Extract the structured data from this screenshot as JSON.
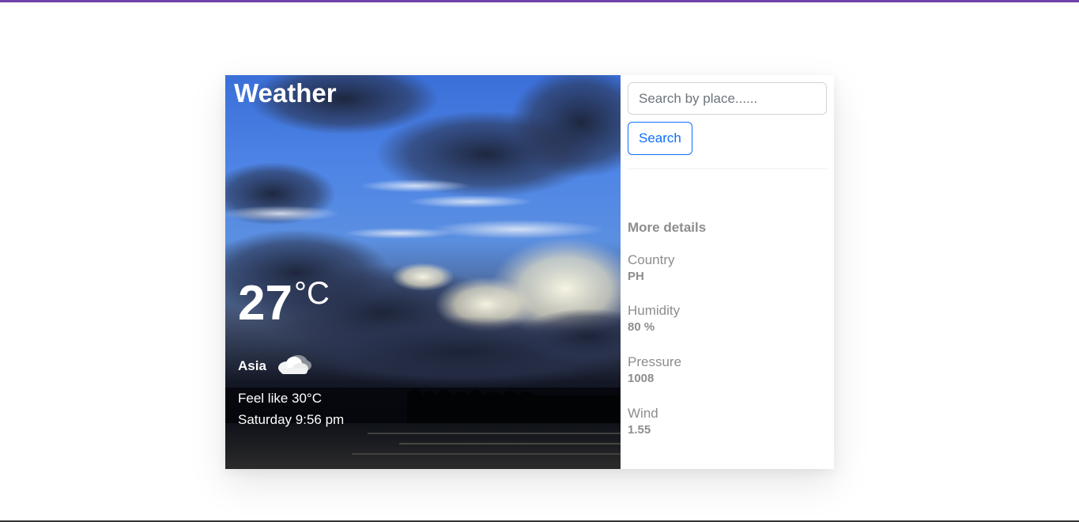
{
  "app": {
    "title": "Weather",
    "accent_color": "#6f42a8"
  },
  "current": {
    "temperature": "27",
    "unit": "°C",
    "location": "Asia",
    "condition_icon": "cloud-icon",
    "feels_like": "Feel like 30°C",
    "datetime": "Saturday 9:56 pm"
  },
  "search": {
    "placeholder": "Search by place......",
    "value": "",
    "button_label": "Search",
    "button_color": "#0d6efd"
  },
  "details": {
    "title": "More details",
    "items": [
      {
        "label": "Country",
        "value": "PH"
      },
      {
        "label": "Humidity",
        "value": "80 %"
      },
      {
        "label": "Pressure",
        "value": "1008"
      },
      {
        "label": "Wind",
        "value": "1.55"
      }
    ]
  }
}
